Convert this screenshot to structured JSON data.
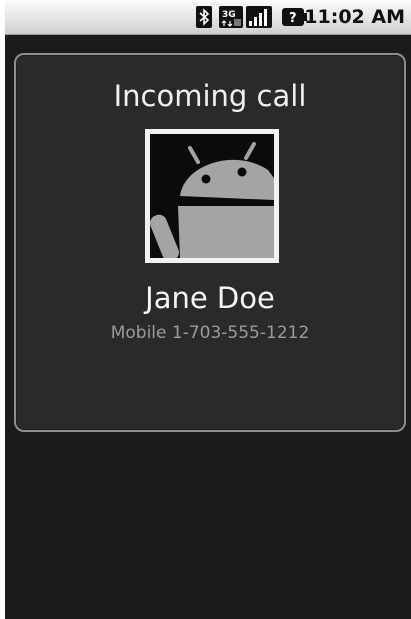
{
  "status_bar": {
    "time": "11:02 AM",
    "icons": [
      "bluetooth-icon",
      "3g-data-icon",
      "signal-strength-icon",
      "battery-unknown-icon"
    ]
  },
  "incoming_call": {
    "state_label": "Incoming call",
    "caller_name": "Jane Doe",
    "number_type": "Mobile",
    "phone_number": "1-703-555-1212",
    "photo": "default-android-contact-photo"
  },
  "colors": {
    "screen_background": "#1b1b1b",
    "card_background": "#2a2a2a",
    "card_border": "#8e8e8e",
    "primary_text": "#f0f0f0",
    "secondary_text": "#9b9b9b",
    "android_green_gray": "#a4a4a4"
  }
}
